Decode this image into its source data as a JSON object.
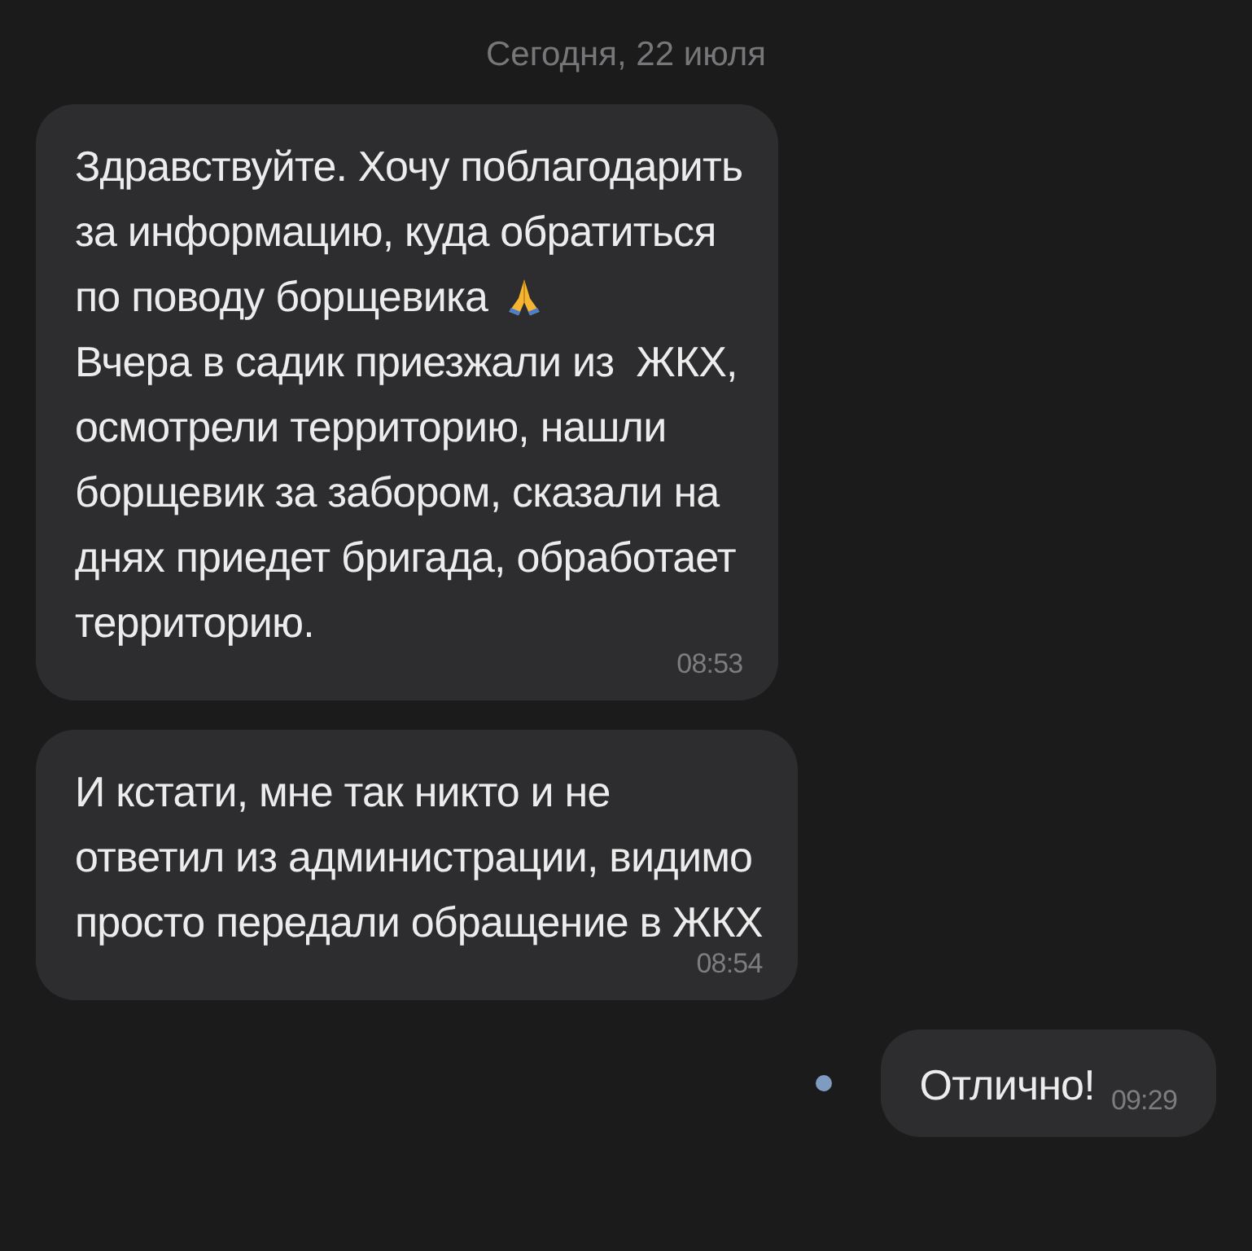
{
  "date_separator": "Сегодня, 22 июля",
  "messages": [
    {
      "kind": "incoming",
      "paragraphs": [
        {
          "kind": "plain",
          "text": "Здравствуйте. Хочу поблагодарить\nза информацию, куда обратиться"
        },
        {
          "kind": "emoji-end",
          "text": "по поводу борщевика"
        },
        {
          "kind": "plain",
          "text": "Вчера в садик приезжали из  ЖКХ,\nосмотрели территорию, нашли\nборщевик за забором, сказали на\nднях приедет бригада, обработает\nтерриторию."
        }
      ],
      "time": "08:53"
    },
    {
      "kind": "incoming",
      "paragraphs": [
        {
          "kind": "plain",
          "text": "И кстати, мне так никто и не\nответил из администрации, видимо\nпросто передали обращение в ЖКХ"
        }
      ],
      "time": "08:54"
    },
    {
      "kind": "outgoing",
      "unread": true,
      "paragraphs": [
        {
          "kind": "plain",
          "text": "Отлично!"
        }
      ],
      "time": "09:29"
    }
  ]
}
